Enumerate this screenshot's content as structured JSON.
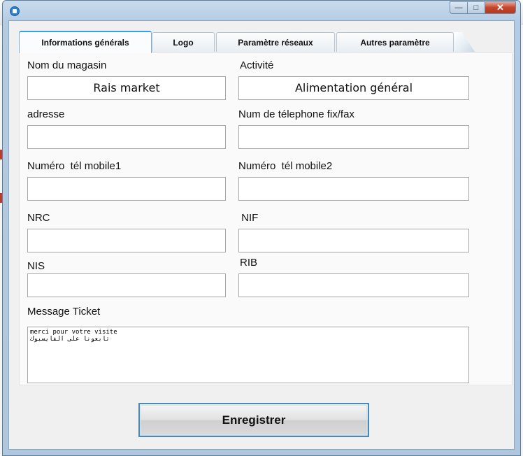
{
  "window": {
    "controls": {
      "minimize": "—",
      "maximize": "□",
      "close": "✕"
    }
  },
  "tabs": [
    {
      "label": "Informations générals"
    },
    {
      "label": "Logo"
    },
    {
      "label": "Paramètre réseaux"
    },
    {
      "label": "Autres paramètre"
    }
  ],
  "form": {
    "nom_label": "Nom du magasin",
    "nom_value": "Rais market",
    "activite_label": "Activité",
    "activite_value": "Alimentation général",
    "adresse_label": "adresse",
    "adresse_value": "",
    "tel_fix_label": "Num de télephone fix/fax",
    "tel_fix_value": "",
    "mobile1_label": "Numéro  tél mobile1",
    "mobile1_value": "",
    "mobile2_label": "Numéro  tél mobile2",
    "mobile2_value": "",
    "nrc_label": "NRC",
    "nrc_value": "",
    "nif_label": " NIF",
    "nif_value": "",
    "nis_label": "NIS",
    "nis_value": "",
    "rib_label": "RIB",
    "rib_value": "",
    "ticket_label": "Message Ticket",
    "ticket_value": "merci pour votre visite\nتابعونا على الفايسبوك"
  },
  "save_label": "Enregistrer"
}
